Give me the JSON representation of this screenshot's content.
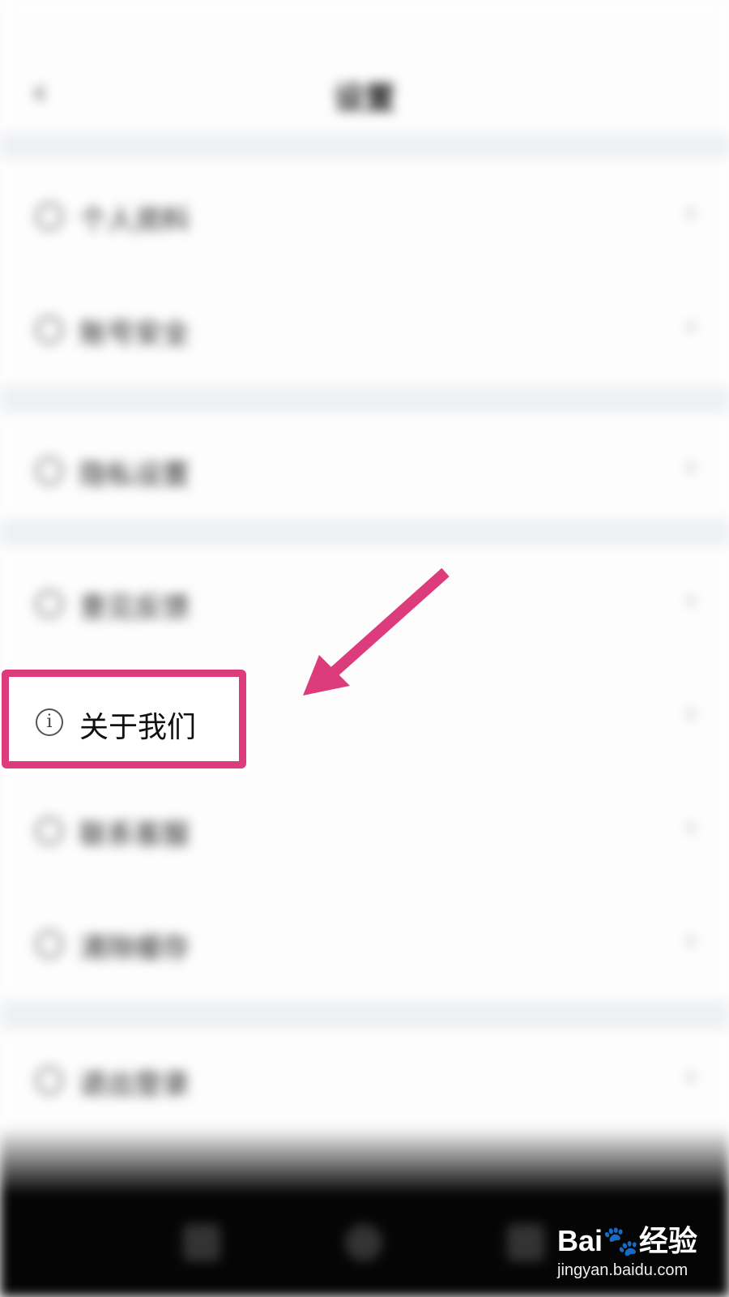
{
  "status_bar": {
    "left": "",
    "right": ""
  },
  "header": {
    "back_icon": "back-arrow-icon",
    "title": "设置"
  },
  "menu": {
    "items": [
      {
        "label": "个人资料",
        "icon": "user-icon"
      },
      {
        "label": "账号安全",
        "icon": "lock-icon"
      },
      {
        "label": "隐私设置",
        "icon": "privacy-icon"
      },
      {
        "label": "意见反馈",
        "icon": "feedback-icon"
      },
      {
        "label": "关于我们",
        "icon": "info-icon"
      },
      {
        "label": "联系客服",
        "icon": "service-icon"
      },
      {
        "label": "清除缓存",
        "icon": "trash-icon",
        "value": ""
      },
      {
        "label": "退出登录",
        "icon": "logout-icon"
      }
    ],
    "highlighted_label": "关于我们",
    "info_glyph": "i"
  },
  "annotation": {
    "highlight_color": "#dc3c7c"
  },
  "watermark": {
    "brand": "Bai🐾经验",
    "url": "jingyan.baidu.com"
  }
}
